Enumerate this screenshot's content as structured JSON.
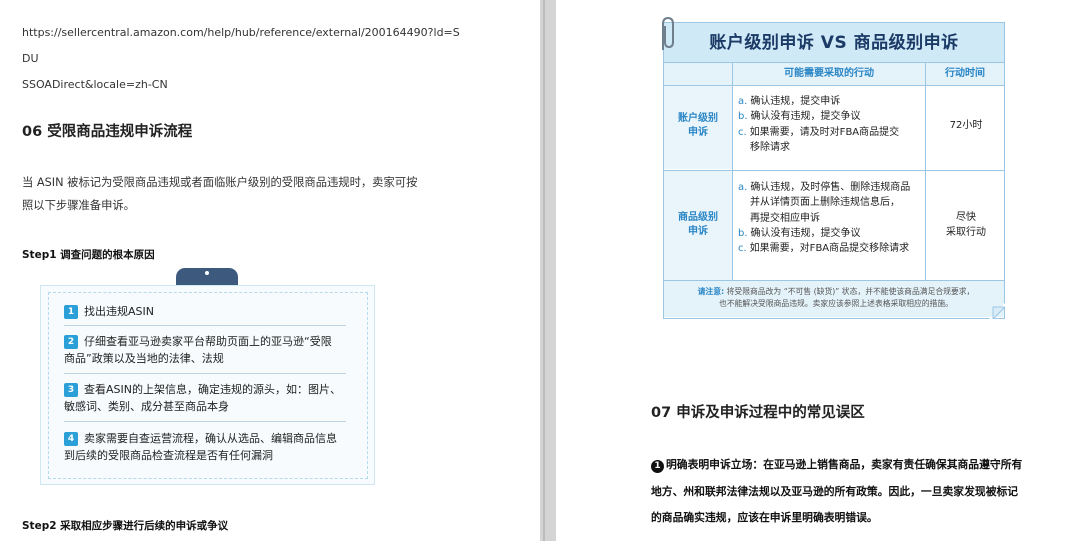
{
  "left_page": {
    "url_line1": "https://sellercentral.amazon.com/help/hub/reference/external/200164490?ld=SDU",
    "url_line2": "SSOADirect&locale=zh-CN",
    "section_title": "06 受限商品违规申诉流程",
    "intro_line1": "当 ASIN 被标记为受限商品违规或者面临账户级别的受限商品违规时，卖家可按",
    "intro_line2": "照以下步骤准备申诉。",
    "step1_heading": "Step1 调查问题的根本原因",
    "steps": [
      {
        "num": "1",
        "line1": "找出违规ASIN",
        "line2": ""
      },
      {
        "num": "2",
        "line1": "仔细查看亚马逊卖家平台帮助页面上的亚马逊“受限",
        "line2": "商品”政策以及当地的法律、法规"
      },
      {
        "num": "3",
        "line1": "查看ASIN的上架信息，确定违规的源头，如：图片、",
        "line2": "敏感词、类别、成分甚至商品本身"
      },
      {
        "num": "4",
        "line1": "卖家需要自查运营流程，确认从选品、编辑商品信息",
        "line2": "到后续的受限商品检查流程是否有任何漏洞"
      }
    ],
    "step2_heading": "Step2 采取相应步骤进行后续的申诉或争议"
  },
  "right_page": {
    "table": {
      "title": "账户级别申诉  VS  商品级别申诉",
      "col_action": "可能需要采取的行动",
      "col_time": "行动时间",
      "account_row": {
        "label_line1": "账户级别",
        "label_line2": "申诉",
        "items": [
          {
            "letter": "a.",
            "text": "确认违规，提交申诉",
            "cont": ""
          },
          {
            "letter": "b.",
            "text": "确认没有违规，提交争议",
            "cont": ""
          },
          {
            "letter": "c.",
            "text": "如果需要，请及时对FBA商品提交",
            "cont": "移除请求"
          }
        ],
        "time": "72小时"
      },
      "product_row": {
        "label_line1": "商品级别",
        "label_line2": "申诉",
        "items": [
          {
            "letter": "a.",
            "text": "确认违规，及时停售、删除违规商品",
            "cont1": "并从详情页面上删除违规信息后，",
            "cont2": "再提交相应申诉"
          },
          {
            "letter": "b.",
            "text": "确认没有违规，提交争议"
          },
          {
            "letter": "c.",
            "text": "如果需要，对FBA商品提交移除请求"
          }
        ],
        "time_line1": "尽快",
        "time_line2": "采取行动"
      },
      "note_label": "请注意:",
      "note_line1": "将受限商品改为 “不可售 (缺货)” 状态，并不能使该商品满足合规要求，",
      "note_line2": "也不能解决受限商品违规。卖家应该参照上述表格采取相应的措施。"
    },
    "section_title": "07 申诉及申诉过程中的常见误区",
    "point_number": "1",
    "point_line1": "明确表明申诉立场：在亚马逊上销售商品，卖家有责任确保其商品遵守所有",
    "point_line2": "地方、州和联邦法律法规以及亚马逊的所有政策。因此，一旦卖家发现被标记",
    "point_line3": "的商品确实违规，应该在申诉里明确表明错误。"
  },
  "colors": {
    "accent_blue": "#2a86c5",
    "number_badge": "#2a9fd8",
    "title_band": "#cfe9f7",
    "title_text": "#1b3a66",
    "card_tab": "#3d5a7e"
  }
}
